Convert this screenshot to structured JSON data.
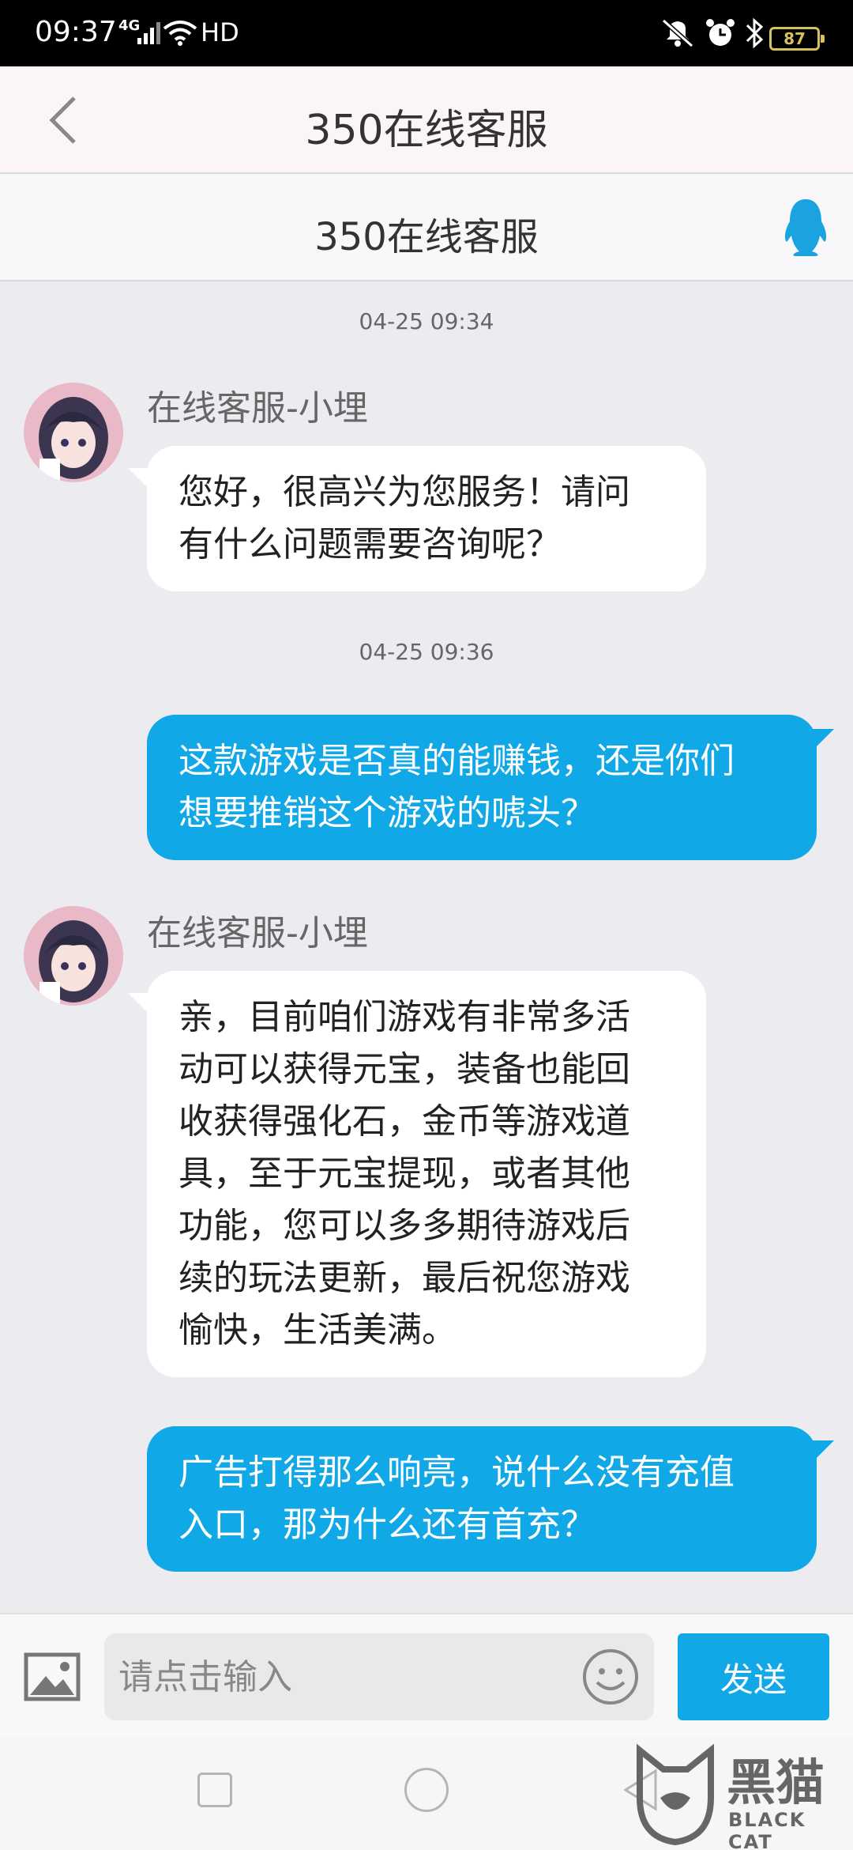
{
  "status_bar": {
    "time": "09:37",
    "network": "4G",
    "hd": "HD",
    "battery": "87"
  },
  "header": {
    "title": "350在线客服"
  },
  "subheader": {
    "title": "350在线客服"
  },
  "messages": [
    {
      "timestamp": "04-25 09:34",
      "sender": "在线客服-小埋",
      "lines": [
        "您好，很高兴为您服务！请问",
        "有什么问题需要咨询呢？"
      ]
    },
    {
      "timestamp": "04-25 09:36",
      "lines": [
        "这款游戏是否真的能赚钱，还是你们",
        "想要推销这个游戏的唬头？"
      ]
    },
    {
      "sender": "在线客服-小埋",
      "lines": [
        "亲，目前咱们游戏有非常多活",
        "动可以获得元宝，装备也能回",
        "收获得强化石，金币等游戏道",
        "具，至于元宝提现，或者其他",
        "功能，您可以多多期待游戏后",
        "续的玩法更新，最后祝您游戏",
        "愉快，生活美满。"
      ]
    },
    {
      "lines": [
        "广告打得那么响亮，说什么没有充值",
        "入口，那为什么还有首充？"
      ]
    }
  ],
  "input": {
    "placeholder": "请点击输入",
    "send_label": "发送"
  },
  "watermark": {
    "text_cn": "黑猫",
    "text_en": "BLACK CAT"
  }
}
